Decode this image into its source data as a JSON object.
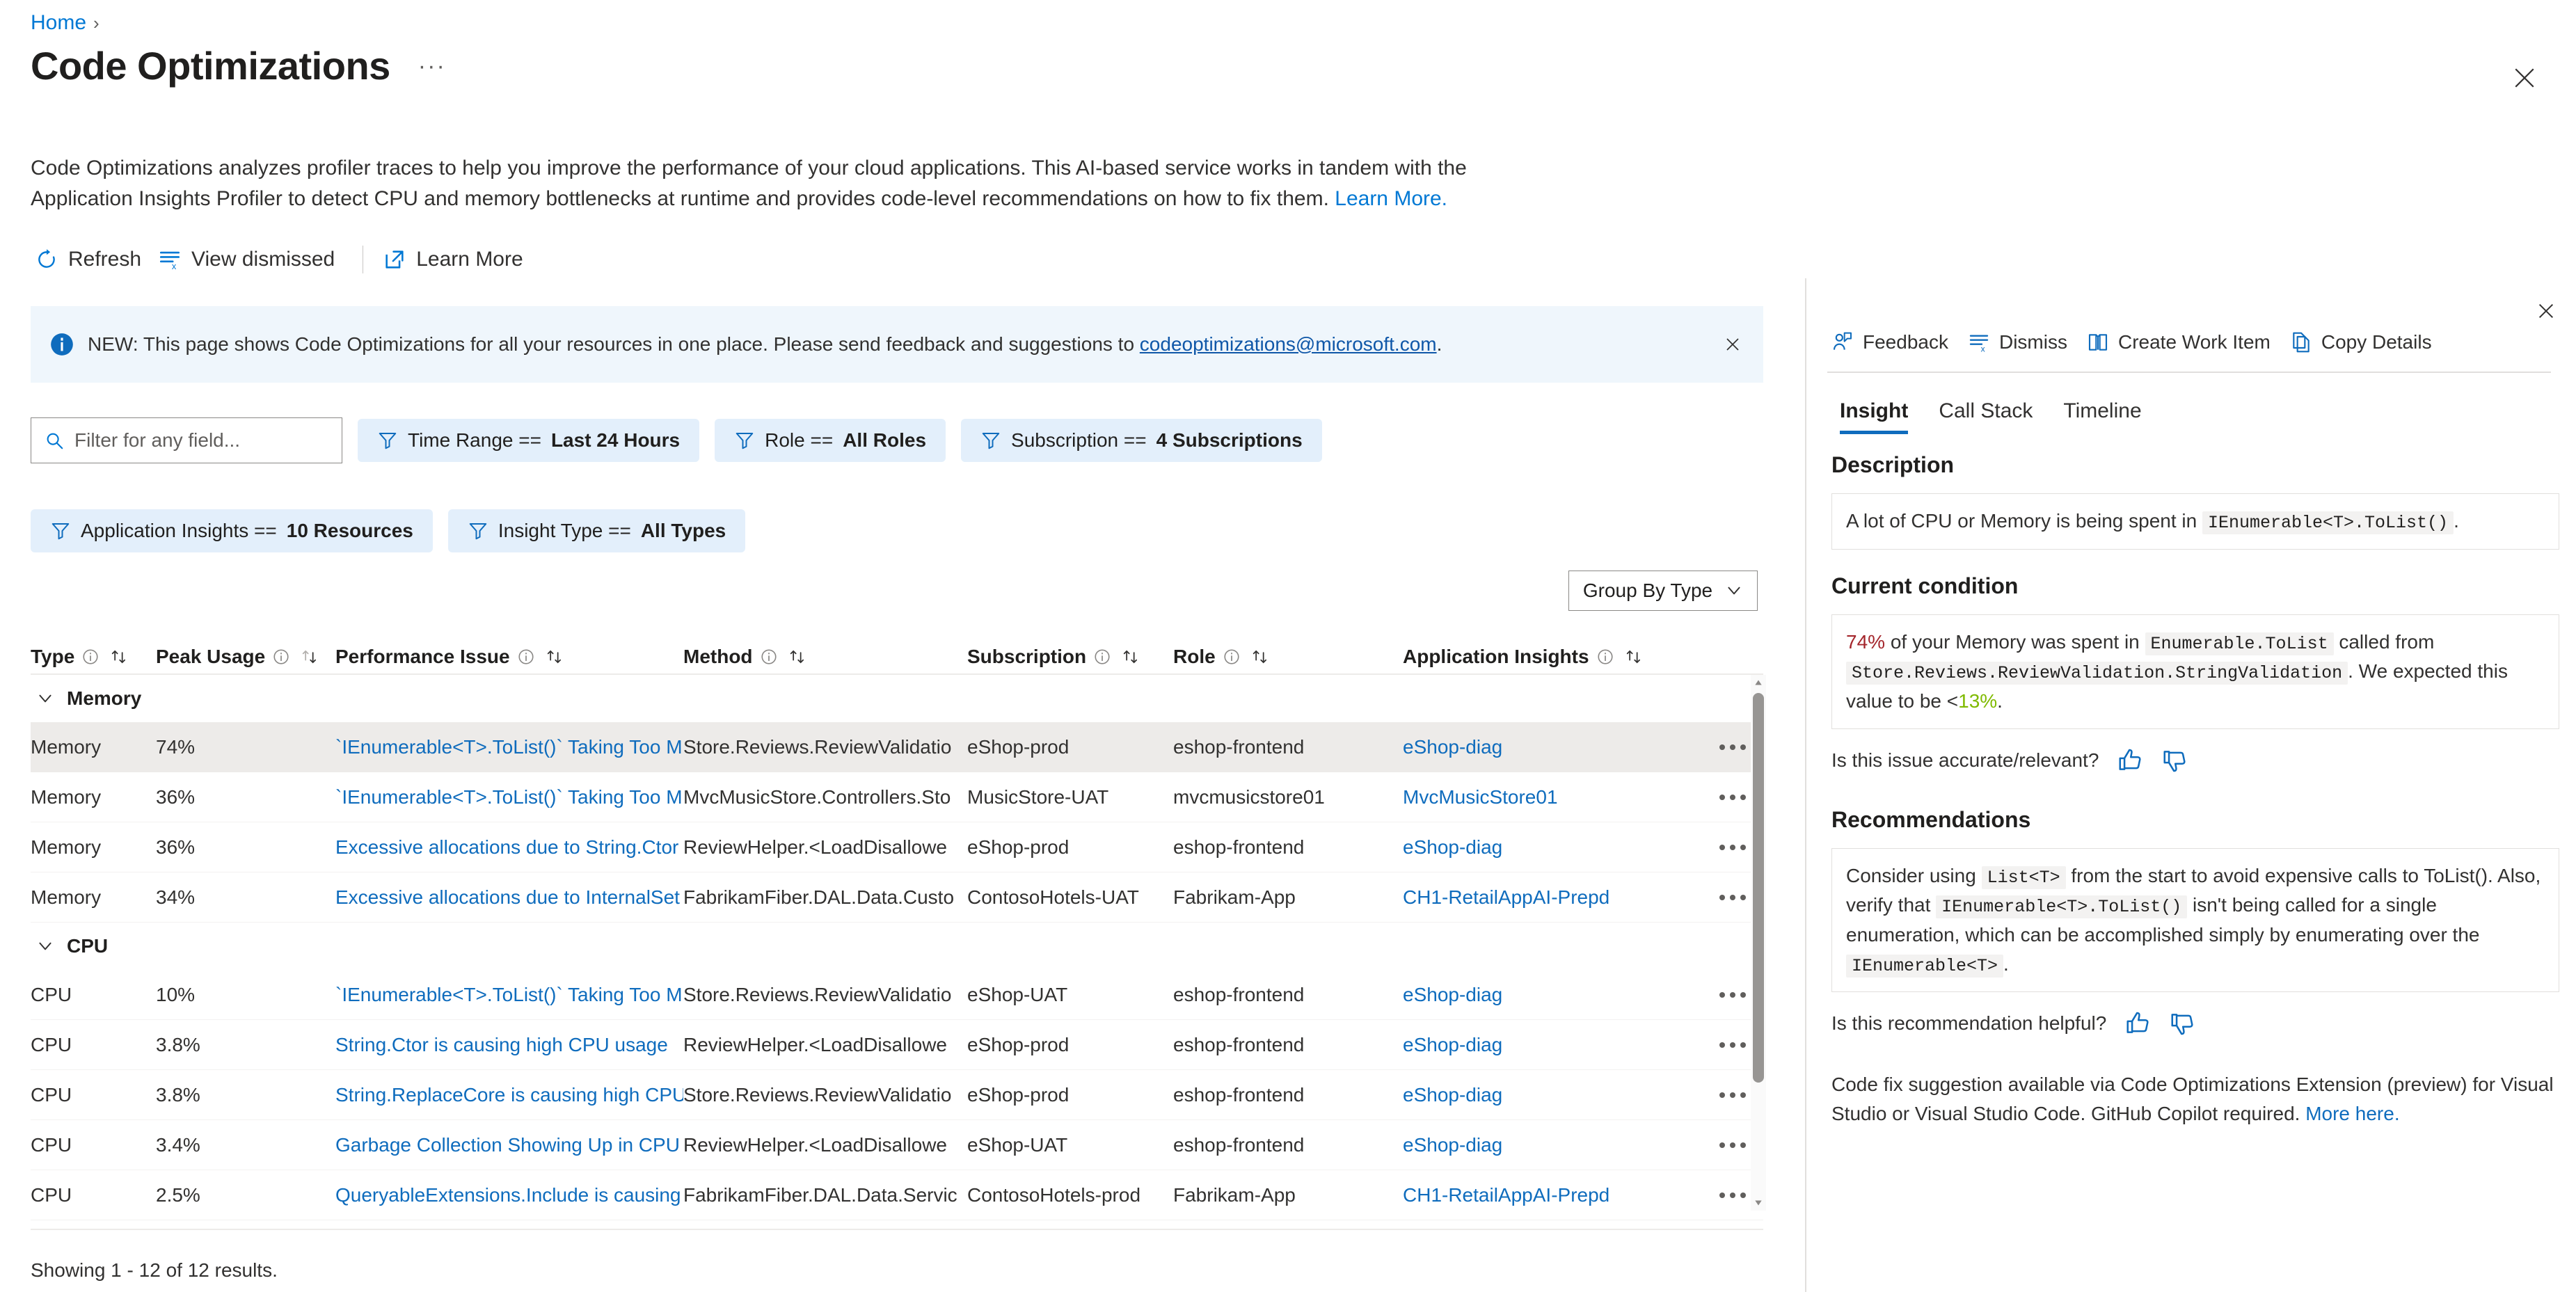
{
  "breadcrumb": {
    "home": "Home",
    "separator": "›"
  },
  "header": {
    "title": "Code Optimizations",
    "ellipsis": "···",
    "close_icon": "close-icon"
  },
  "intro": {
    "line1": "Code Optimizations analyzes profiler traces to help you improve the performance of your cloud applications. This AI-based service works in tandem with the",
    "line2": "Application Insights Profiler to detect CPU and memory bottlenecks at runtime and provides code-level recommendations on how to fix them.",
    "link": "Learn More."
  },
  "commandbar": {
    "refresh": "Refresh",
    "view_dismissed": "View dismissed",
    "learn_more": "Learn More"
  },
  "banner": {
    "prefix": "NEW: This page shows Code Optimizations for all your resources in one place. Please send feedback and suggestions to",
    "email": "codeoptimizations@microsoft.com",
    "suffix": ".",
    "background": "#eff6fc"
  },
  "filters": {
    "search_placeholder": "Filter for any field...",
    "chips": [
      {
        "label": "Time Range ==",
        "value": "Last 24 Hours"
      },
      {
        "label": "Role ==",
        "value": "All Roles"
      },
      {
        "label": "Subscription ==",
        "value": "4 Subscriptions"
      },
      {
        "label": "Application Insights ==",
        "value": "10 Resources"
      },
      {
        "label": "Insight Type ==",
        "value": "All Types"
      }
    ]
  },
  "groupby": {
    "label": "Group By Type"
  },
  "table": {
    "columns": [
      {
        "key": "type",
        "label": "Type"
      },
      {
        "key": "peak",
        "label": "Peak Usage"
      },
      {
        "key": "perf",
        "label": "Performance Issue"
      },
      {
        "key": "method",
        "label": "Method"
      },
      {
        "key": "subscription",
        "label": "Subscription"
      },
      {
        "key": "role",
        "label": "Role"
      },
      {
        "key": "appinsights",
        "label": "Application Insights"
      }
    ],
    "groups": [
      {
        "name": "Memory",
        "rows": [
          {
            "type": "Memory",
            "peak": "74%",
            "perf": "`IEnumerable<T>.ToList()` Taking Too M",
            "method": "Store.Reviews.ReviewValidatio",
            "subscription": "eShop-prod",
            "role": "eshop-frontend",
            "appinsights": "eShop-diag",
            "selected": true
          },
          {
            "type": "Memory",
            "peak": "36%",
            "perf": "`IEnumerable<T>.ToList()` Taking Too M",
            "method": "MvcMusicStore.Controllers.Sto",
            "subscription": "MusicStore-UAT",
            "role": "mvcmusicstore01",
            "appinsights": "MvcMusicStore01",
            "selected": false
          },
          {
            "type": "Memory",
            "peak": "36%",
            "perf": "Excessive allocations due to String.Ctor",
            "method": "ReviewHelper.<LoadDisallowe",
            "subscription": "eShop-prod",
            "role": "eshop-frontend",
            "appinsights": "eShop-diag",
            "selected": false
          },
          {
            "type": "Memory",
            "peak": "34%",
            "perf": "Excessive allocations due to InternalSet",
            "method": "FabrikamFiber.DAL.Data.Custo",
            "subscription": "ContosoHotels-UAT",
            "role": "Fabrikam-App",
            "appinsights": "CH1-RetailAppAI-Prepd",
            "selected": false
          }
        ]
      },
      {
        "name": "CPU",
        "rows": [
          {
            "type": "CPU",
            "peak": "10%",
            "perf": "`IEnumerable<T>.ToList()` Taking Too M",
            "method": "Store.Reviews.ReviewValidatio",
            "subscription": "eShop-UAT",
            "role": "eshop-frontend",
            "appinsights": "eShop-diag",
            "selected": false
          },
          {
            "type": "CPU",
            "peak": "3.8%",
            "perf": "String.Ctor is causing high CPU usage",
            "method": "ReviewHelper.<LoadDisallowe",
            "subscription": "eShop-prod",
            "role": "eshop-frontend",
            "appinsights": "eShop-diag",
            "selected": false
          },
          {
            "type": "CPU",
            "peak": "3.8%",
            "perf": "String.ReplaceCore is causing high CPU",
            "method": "Store.Reviews.ReviewValidatio",
            "subscription": "eShop-prod",
            "role": "eshop-frontend",
            "appinsights": "eShop-diag",
            "selected": false
          },
          {
            "type": "CPU",
            "peak": "3.4%",
            "perf": "Garbage Collection Showing Up in CPU",
            "method": "ReviewHelper.<LoadDisallowe",
            "subscription": "eShop-UAT",
            "role": "eshop-frontend",
            "appinsights": "eShop-diag",
            "selected": false
          },
          {
            "type": "CPU",
            "peak": "2.5%",
            "perf": "QueryableExtensions.Include is causing",
            "method": "FabrikamFiber.DAL.Data.Servic",
            "subscription": "ContosoHotels-prod",
            "role": "Fabrikam-App",
            "appinsights": "CH1-RetailAppAI-Prepd",
            "selected": false
          }
        ]
      }
    ],
    "footer": "Showing 1 - 12 of 12 results."
  },
  "detail": {
    "commands": [
      {
        "label": "Feedback",
        "icon": "person-feedback-icon"
      },
      {
        "label": "Dismiss",
        "icon": "dismiss-list-icon"
      },
      {
        "label": "Create Work Item",
        "icon": "book-icon"
      },
      {
        "label": "Copy Details",
        "icon": "copy-icon"
      }
    ],
    "tabs": [
      {
        "label": "Insight",
        "active": true
      },
      {
        "label": "Call Stack",
        "active": false
      },
      {
        "label": "Timeline",
        "active": false
      }
    ],
    "description": {
      "heading": "Description",
      "text_before": "A lot of CPU or Memory is being spent in",
      "code": "IEnumerable<T>.ToList()",
      "text_after": "."
    },
    "current_condition": {
      "heading": "Current condition",
      "percent": "74%",
      "text1": "of your Memory was spent in",
      "code1": "Enumerable.ToList",
      "text2": "called from",
      "code2": "Store.Reviews.ReviewValidation.StringValidation",
      "text3": ". We expected this value to be <",
      "expected": "13%",
      "text4": "."
    },
    "issue_feedback": {
      "question": "Is this issue accurate/relevant?",
      "thumbs_up": "thumbs-up-icon",
      "thumbs_down": "thumbs-down-icon"
    },
    "recommendations": {
      "heading": "Recommendations",
      "t1": "Consider using",
      "c1": "List<T>",
      "t2": "from the start to avoid expensive calls to ToList(). Also, verify that",
      "c2": "IEnumerable<T>.ToList()",
      "t3": "isn't being called for a single enumeration, which can be accomplished simply by enumerating over the",
      "c3": "IEnumerable<T>",
      "t4": "."
    },
    "rec_feedback": {
      "question": "Is this recommendation helpful?"
    },
    "note": {
      "text": "Code fix suggestion available via Code Optimizations Extension (preview) for Visual Studio or Visual Studio Code. GitHub Copilot required.",
      "link": "More here."
    },
    "close_icon": "close-icon"
  },
  "colors": {
    "accent": "#0078d4",
    "link": "#0f6cbd",
    "banner_bg": "#eff6fc",
    "chip_bg": "#e3effb",
    "selected_row": "#edebe9",
    "hot": "#a4262c",
    "good": "#7fba00"
  }
}
